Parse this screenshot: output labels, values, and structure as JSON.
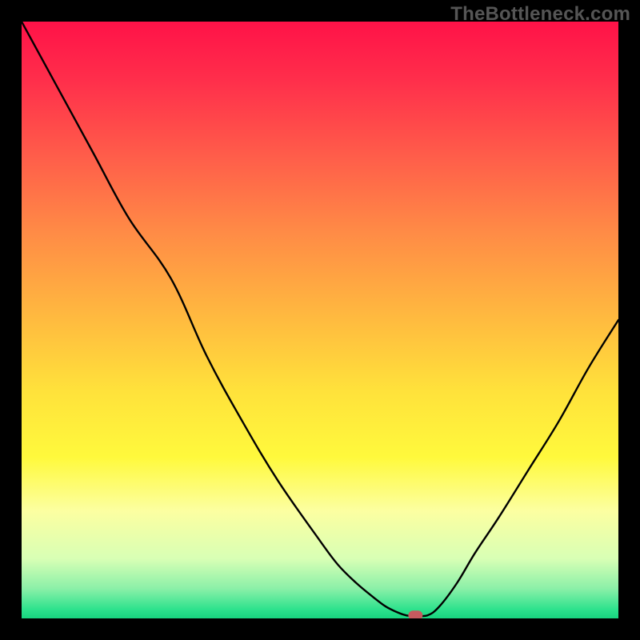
{
  "watermark": "TheBottleneck.com",
  "chart_data": {
    "type": "line",
    "title": "",
    "xlabel": "",
    "ylabel": "",
    "xlim": [
      0,
      100
    ],
    "ylim": [
      0,
      100
    ],
    "x": [
      0,
      6,
      12,
      18,
      25,
      31,
      37,
      43,
      50,
      53,
      56,
      59,
      61,
      63,
      64.5,
      66,
      68,
      70,
      73,
      76,
      80,
      85,
      90,
      95,
      100
    ],
    "values": [
      100,
      89,
      78,
      67,
      57,
      44,
      33,
      23,
      13,
      9,
      6,
      3.5,
      2,
      1,
      0.5,
      0.5,
      0.5,
      2,
      6,
      11,
      17,
      25,
      33,
      42,
      50
    ],
    "marker": {
      "x": 66,
      "y": 0.5
    },
    "gradient_stops": [
      {
        "offset": 0.0,
        "color": "#ff1248"
      },
      {
        "offset": 0.1,
        "color": "#ff2f4b"
      },
      {
        "offset": 0.22,
        "color": "#ff5b4a"
      },
      {
        "offset": 0.35,
        "color": "#ff8a46"
      },
      {
        "offset": 0.5,
        "color": "#ffbb3f"
      },
      {
        "offset": 0.62,
        "color": "#ffe23b"
      },
      {
        "offset": 0.73,
        "color": "#fff93c"
      },
      {
        "offset": 0.82,
        "color": "#fcffa1"
      },
      {
        "offset": 0.9,
        "color": "#d8ffb5"
      },
      {
        "offset": 0.95,
        "color": "#8bf0a8"
      },
      {
        "offset": 0.985,
        "color": "#2de28d"
      },
      {
        "offset": 1.0,
        "color": "#18d47f"
      }
    ]
  }
}
